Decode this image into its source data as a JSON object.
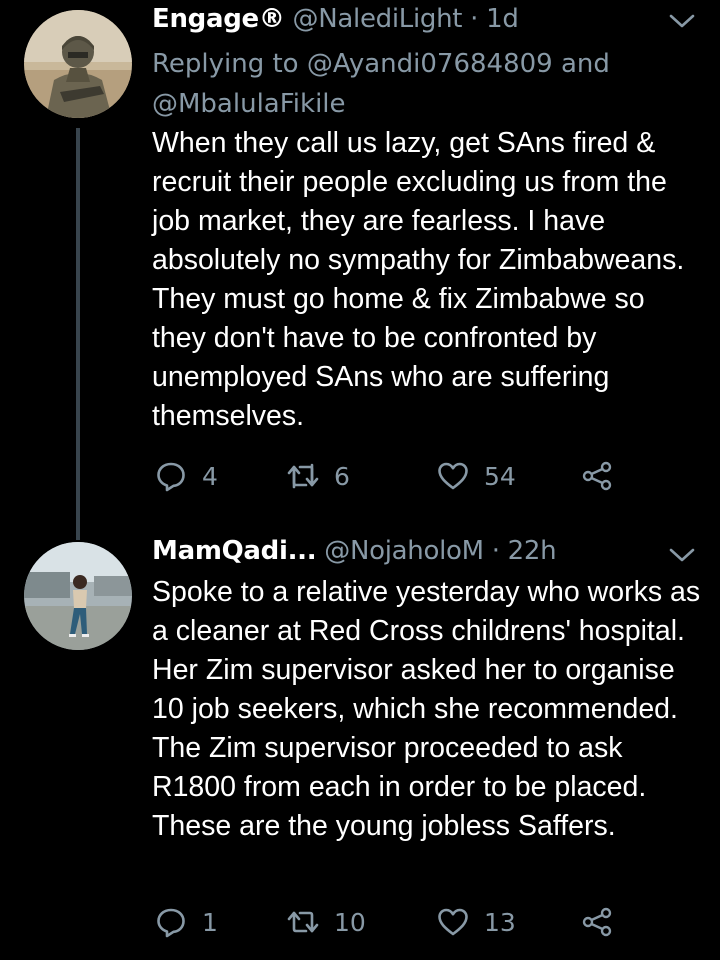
{
  "colors": {
    "background": "#000000",
    "primary_text": "#ffffff",
    "secondary_text": "#8899a6",
    "thread_line": "#38444d"
  },
  "tweets": [
    {
      "name": "Engage®",
      "handle": "@NalediLight",
      "separator": "·",
      "time": "1d",
      "replying_to": "Replying to @Ayandi07684809 and @MbalulaFikile",
      "text": "When they call us lazy, get SAns fired & recruit their people excluding us from the job market, they are fearless. I have absolutely no sympathy for Zimbabweans. They must go home & fix Zimbabwe so they don't have to be confronted by unemployed SAns who are suffering themselves.",
      "replies": "4",
      "retweets": "6",
      "likes": "54",
      "avatar_icon": "soldier-avatar"
    },
    {
      "name": "MamQadi...",
      "handle": "@NojaholoM",
      "separator": "·",
      "time": "22h",
      "text": "Spoke to a relative yesterday who works as a cleaner at Red Cross childrens' hospital. Her Zim supervisor asked her to organise 10 job seekers, which she recommended. The Zim supervisor proceeded to ask R1800 from each in order to be placed. These are the young jobless Saffers.",
      "replies": "1",
      "retweets": "10",
      "likes": "13",
      "avatar_icon": "person-outdoors-avatar"
    }
  ]
}
